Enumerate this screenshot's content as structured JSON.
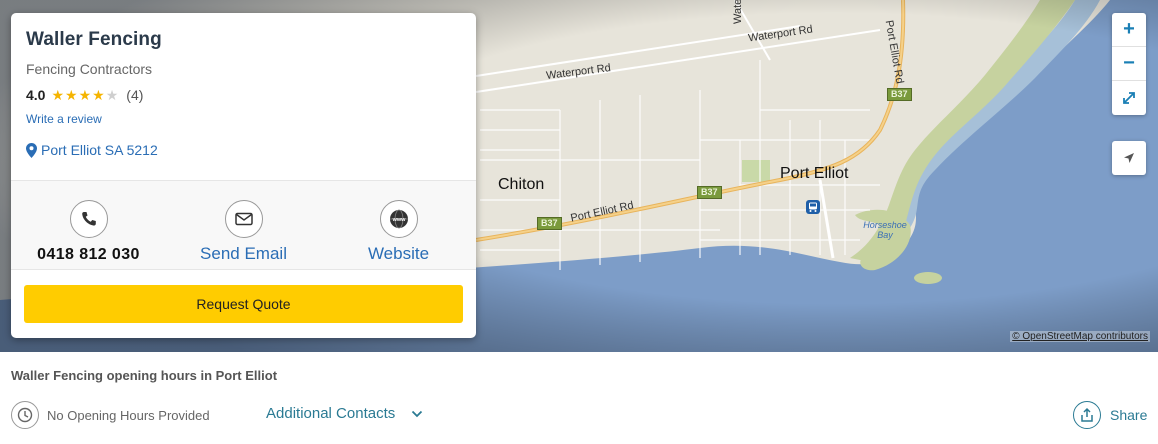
{
  "business": {
    "name": "Waller Fencing",
    "category": "Fencing Contractors",
    "rating": "4.0",
    "rating_stars": 4,
    "rating_max": 5,
    "review_count": "(4)",
    "write_review_label": "Write a review",
    "location": "Port Elliot SA 5212"
  },
  "contacts": {
    "phone": {
      "label": "0418 812 030",
      "icon": "phone-icon"
    },
    "email": {
      "label": "Send Email",
      "icon": "mail-icon"
    },
    "website": {
      "label": "Website",
      "icon": "www-globe-icon"
    }
  },
  "quote_button_label": "Request Quote",
  "map": {
    "labels": {
      "town_chiton": "Chiton",
      "town_port_elliot": "Port Elliot",
      "road_waterport_1": "Waterport Rd",
      "road_waterport_2": "Waterport Rd",
      "road_port_elliot_ne": "Port Elliot Rd",
      "road_port_elliot_w": "Port Elliot Rd",
      "road_waterport_vertical": "Waterport Rd",
      "shield_b37_1": "B37",
      "shield_b37_2": "B37",
      "shield_b37_3": "B37",
      "bay": "Horseshoe Bay"
    },
    "attribution": "© OpenStreetMap contributors",
    "controls": {
      "zoom_in": "+",
      "zoom_out": "−"
    },
    "colors": {
      "water": "#7d9dc8",
      "land": "#e6e3d8",
      "coast": "#c9d3a4",
      "main_road": "#e8b45c"
    }
  },
  "hours": {
    "title": "Waller Fencing opening hours in Port Elliot",
    "status": "No Opening Hours Provided"
  },
  "additional_contacts_label": "Additional Contacts",
  "share_label": "Share",
  "colors": {
    "accent_yellow": "#ffcc00",
    "link_blue": "#2a6db5",
    "teal": "#2a7a93",
    "star": "#f5b400"
  }
}
